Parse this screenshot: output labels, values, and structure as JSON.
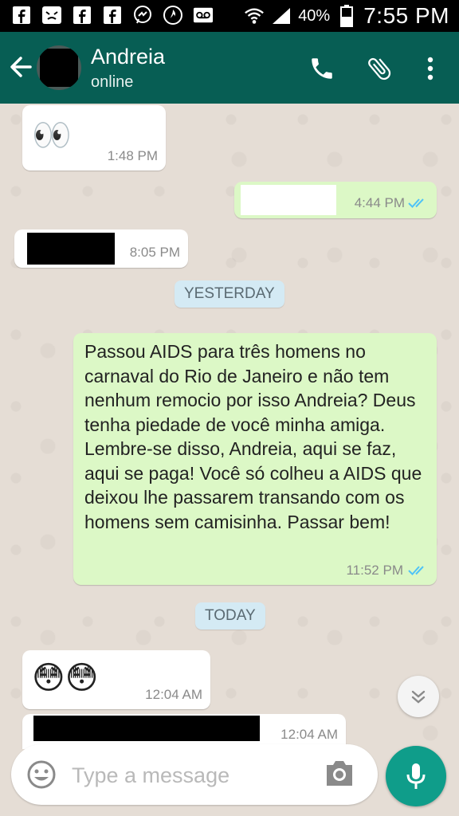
{
  "status_bar": {
    "battery": "40%",
    "time": "7:55 PM"
  },
  "header": {
    "contact_name": "Andreia",
    "contact_status": "online",
    "icons": [
      "back-arrow-icon",
      "phone-icon",
      "paperclip-icon",
      "more-vert-icon"
    ]
  },
  "chat": {
    "messages": [
      {
        "direction": "in",
        "content": "👀",
        "time": "1:48 PM"
      },
      {
        "direction": "out",
        "content": "",
        "time": "4:44 PM",
        "read": true
      },
      {
        "direction": "in",
        "content": "",
        "time": "8:05 PM"
      },
      {
        "day_separator": "YESTERDAY"
      },
      {
        "direction": "out",
        "content": "Passou AIDS para três homens no carnaval do Rio de Janeiro e não tem nenhum remocio por isso Andreia? Deus tenha piedade de você minha amiga. Lembre-se disso, Andreia, aqui se faz, aqui se paga! Você só colheu a AIDS que deixou lhe passarem transando com os homens sem camisinha. Passar bem!",
        "time": "11:52 PM",
        "read": true
      },
      {
        "day_separator": "TODAY"
      },
      {
        "direction": "in",
        "content": "😳😳",
        "time": "12:04 AM"
      },
      {
        "direction": "in",
        "content": "",
        "time": "12:04 AM"
      }
    ]
  },
  "input": {
    "placeholder": "Type a message"
  },
  "colors": {
    "header": "#075e54",
    "outgoing_bubble": "#dcf8c6",
    "incoming_bubble": "#ffffff",
    "read_ticks": "#4fc3f7",
    "mic_button": "#0f9d8a"
  }
}
